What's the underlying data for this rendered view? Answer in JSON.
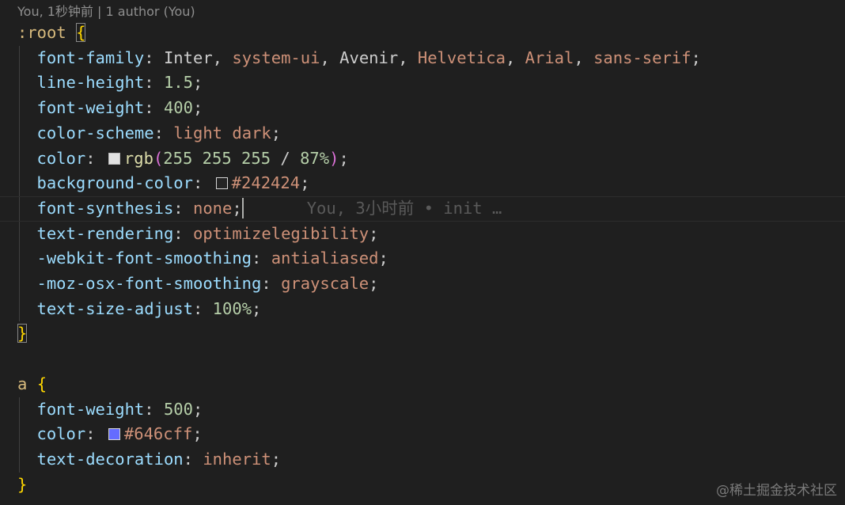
{
  "codelens": {
    "text": "You, 1秒钟前 | 1 author (You)"
  },
  "inline_blame": {
    "text": "You, 3小时前 • init …"
  },
  "colors": {
    "swatch_text_color": "#ffffff",
    "swatch_background": "#242424",
    "swatch_link_color": "#646cff"
  },
  "code": {
    "root_selector": ":root",
    "open_brace": "{",
    "close_brace": "}",
    "root_rules": [
      {
        "prop": "font-family",
        "value": "Inter, system-ui, Avenir, Helvetica, Arial, sans-serif;"
      },
      {
        "prop": "line-height",
        "value": "1.5;"
      },
      {
        "prop": "font-weight",
        "value": "400;"
      },
      {
        "prop": "color-scheme",
        "value": "light dark;"
      },
      {
        "prop": "color",
        "value": "rgb(255 255 255 / 87%);"
      },
      {
        "prop": "background-color",
        "value": "#242424;"
      },
      {
        "prop": "font-synthesis",
        "value": "none;"
      },
      {
        "prop": "text-rendering",
        "value": "optimizelegibility;"
      },
      {
        "prop": "-webkit-font-smoothing",
        "value": "antialiased;"
      },
      {
        "prop": "-moz-osx-font-smoothing",
        "value": "grayscale;"
      },
      {
        "prop": "text-size-adjust",
        "value": "100%;"
      }
    ],
    "a_selector": "a",
    "a_rules": [
      {
        "prop": "font-weight",
        "value": "500;"
      },
      {
        "prop": "color",
        "value": "#646cff;"
      },
      {
        "prop": "text-decoration",
        "value": "inherit;"
      }
    ]
  },
  "watermark": {
    "text": "@稀土掘金技术社区"
  }
}
